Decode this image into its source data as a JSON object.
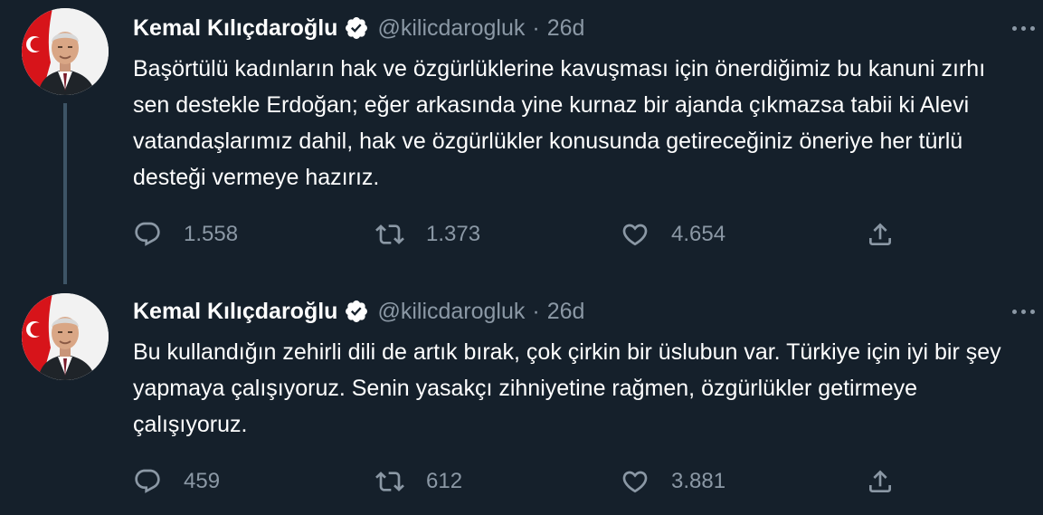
{
  "colors": {
    "background": "#15202b",
    "text": "#ffffff",
    "secondary_text": "#8b98a5",
    "thread_line": "#3d5466",
    "verified_badge": "#ffffff"
  },
  "tweets": [
    {
      "author": {
        "name": "Kemal Kılıçdaroğlu",
        "handle": "@kilicdarogluk",
        "verified": true,
        "verified_icon": "verified-badge-icon"
      },
      "separator": "·",
      "time": "26d",
      "text": "Başörtülü kadınların hak ve özgürlüklerine kavuşması için önerdiğimiz bu kanuni zırhı sen destekle Erdoğan; eğer arkasında yine kurnaz bir ajanda çıkmazsa tabii ki Alevi vatandaşlarımız dahil, hak ve özgürlükler konusunda getireceğiniz öneriye her türlü desteği vermeye hazırız.",
      "replies": "1.558",
      "retweets": "1.373",
      "likes": "4.654"
    },
    {
      "author": {
        "name": "Kemal Kılıçdaroğlu",
        "handle": "@kilicdarogluk",
        "verified": true,
        "verified_icon": "verified-badge-icon"
      },
      "separator": "·",
      "time": "26d",
      "text": "Bu kullandığın zehirli dili de artık bırak, çok çirkin bir üslubun var. Türkiye için iyi bir şey yapmaya çalışıyoruz. Senin yasakçı zihniyetine rağmen, özgürlükler getirmeye çalışıyoruz.",
      "replies": "459",
      "retweets": "612",
      "likes": "3.881"
    }
  ],
  "icons": {
    "reply": "reply-icon",
    "retweet": "retweet-icon",
    "like": "heart-icon",
    "share": "share-icon",
    "more": "more-options-icon"
  }
}
